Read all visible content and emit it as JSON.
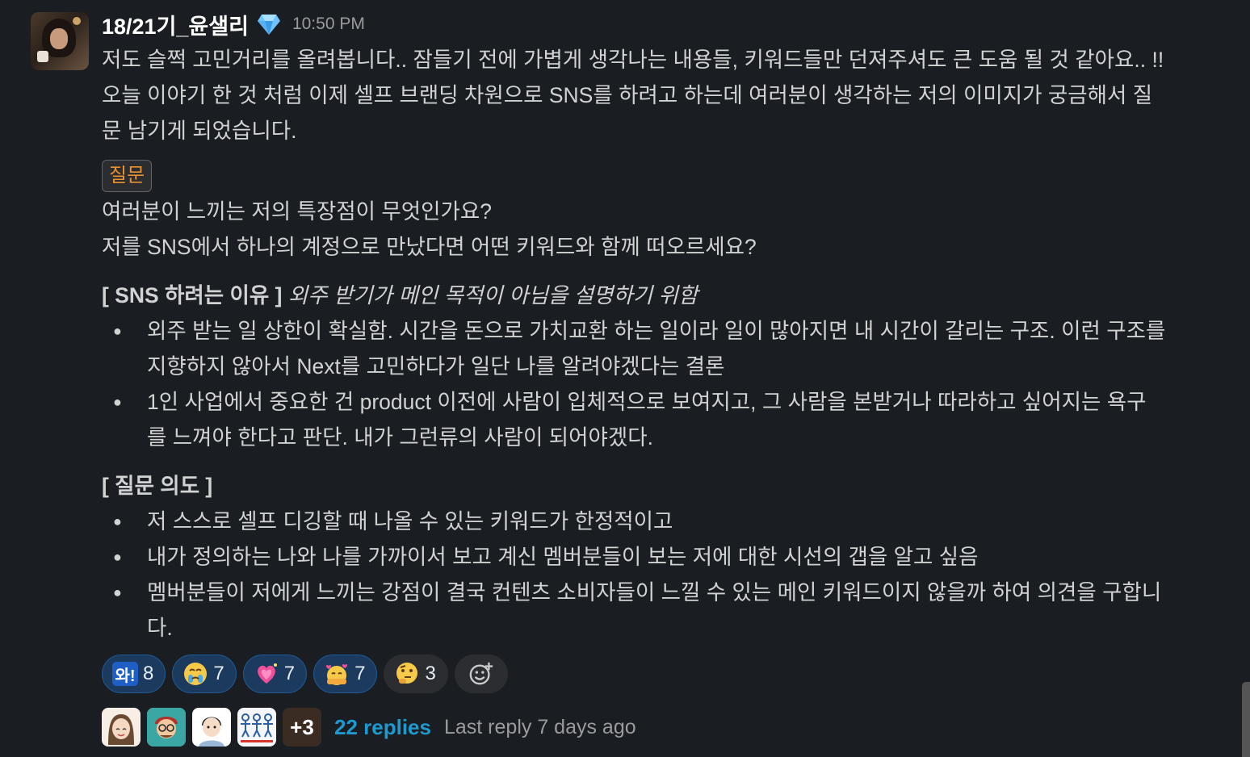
{
  "message": {
    "author": "18/21기_윤샐리",
    "badge_icon": "gem-icon",
    "time": "10:50 PM",
    "intro": [
      "저도 슬쩍 고민거리를 올려봅니다.. 잠들기 전에 가볍게 생각나는 내용들, 키워드들만 던져주셔도 큰 도움 될 것 같아요.. !!",
      "오늘 이야기 한 것 처럼 이제 셀프 브랜딩 차원으로 SNS를 하려고 하는데 여러분이 생각하는 저의 이미지가 궁금해서 질",
      "문 남기게 되었습니다."
    ],
    "tag": "질문",
    "questions": [
      "여러분이 느끼는 저의 특장점이 무엇인가요?",
      "저를 SNS에서 하나의 계정으로 만났다면 어떤 키워드와 함께 떠오르세요?"
    ],
    "section1": {
      "title": "[ SNS 하려는 이유 ]",
      "subtitle": "외주 받기가 메인 목적이 아님을 설명하기 위함",
      "bullets": [
        [
          "외주 받는 일 상한이 확실함. 시간을 돈으로 가치교환 하는 일이라 일이 많아지면 내 시간이 갈리는 구조. 이런 구조를",
          "지향하지 않아서 Next를 고민하다가 일단 나를 알려야겠다는 결론"
        ],
        [
          "1인 사업에서 중요한 건 product 이전에 사람이 입체적으로 보여지고, 그 사람을 본받거나 따라하고 싶어지는 욕구",
          "를 느껴야 한다고 판단. 내가 그런류의 사람이 되어야겠다."
        ]
      ]
    },
    "section2": {
      "title": "[ 질문 의도 ]",
      "bullets": [
        [
          "저 스스로 셀프 디깅할 때 나올 수 있는 키워드가 한정적이고"
        ],
        [
          "내가 정의하는 나와 나를 가까이서 보고 계신 멤버분들이 보는 저에 대한 시선의 갭을 알고 싶음"
        ],
        [
          "멤버분들이 저에게 느끼는 강점이 결국 컨텐츠 소비자들이 느낄 수 있는 메인 키워드이지 않을까 하여 의견을 구합니",
          "다."
        ]
      ]
    }
  },
  "reactions": [
    {
      "emoji": "wa-emoji",
      "label": "와!",
      "count": "8"
    },
    {
      "emoji": "crying-face-icon",
      "count": "7"
    },
    {
      "emoji": "sparkling-heart-icon",
      "count": "7"
    },
    {
      "emoji": "hugging-hearts-icon",
      "count": "7"
    },
    {
      "emoji": "thinking-face-icon",
      "count": "3"
    }
  ],
  "thread": {
    "more_count": "+3",
    "replies": "22 replies",
    "last_reply": "Last reply 7 days ago"
  }
}
